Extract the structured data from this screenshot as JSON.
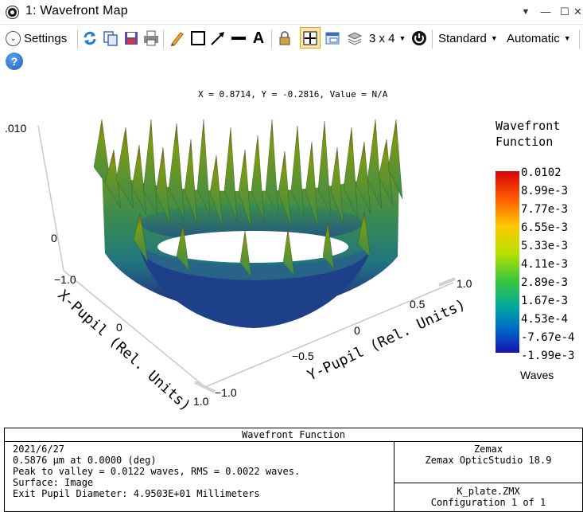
{
  "window": {
    "title": "1: Wavefront Map"
  },
  "toolbar": {
    "settings_label": "Settings",
    "layout_label": "3 x 4",
    "standard_label": "Standard",
    "automatic_label": "Automatic",
    "icons": [
      "refresh-icon",
      "copy-icon",
      "save-icon",
      "print-icon",
      "pencil-icon",
      "rectangle-icon",
      "arrow-line-icon",
      "line-icon",
      "text-icon",
      "lock-icon",
      "cursor-crosshair-icon",
      "window-icon",
      "layers-icon",
      "power-icon",
      "help-icon"
    ]
  },
  "plot": {
    "cursor_readout": "X = 0.8714, Y = -0.2816, Value = N/A",
    "z_ticks": [
      ".010",
      "0"
    ],
    "x_axis_label": "X-Pupil (Rel. Units)",
    "x_ticks": [
      "−1.0",
      "0",
      "1.0"
    ],
    "y_axis_label": "Y-Pupil (Rel. Units)",
    "y_ticks": [
      "−1.0",
      "−0.5",
      "0",
      "0.5",
      "1.0"
    ],
    "colors": {
      "surface_low": "#1f1a8c",
      "surface_mid": "#2a8a7a",
      "surface_high": "#6a9a1e"
    }
  },
  "legend": {
    "title_line1": "Wavefront",
    "title_line2": "Function",
    "values": [
      "0.0102",
      "8.99e-3",
      "7.77e-3",
      "6.55e-3",
      "5.33e-3",
      "4.11e-3",
      "2.89e-3",
      "1.67e-3",
      "4.53e-4",
      "-7.67e-4",
      "-1.99e-3"
    ],
    "units": "Waves",
    "gradient": [
      "#d7000a",
      "#ff6a00",
      "#ffd200",
      "#a8e000",
      "#3cc83c",
      "#00a8a0",
      "#0062c8",
      "#1a10b0"
    ]
  },
  "info": {
    "title": "Wavefront Function",
    "lines": [
      "2021/6/27",
      "0.5876 µm at 0.0000 (deg)",
      "Peak to valley = 0.0122 waves, RMS = 0.0022 waves.",
      "Surface: Image",
      "Exit Pupil Diameter: 4.9503E+01 Millimeters"
    ],
    "vendor": "Zemax",
    "product": "Zemax OpticStudio 18.9",
    "file": "K_plate.ZMX",
    "configuration": "Configuration 1 of 1"
  }
}
